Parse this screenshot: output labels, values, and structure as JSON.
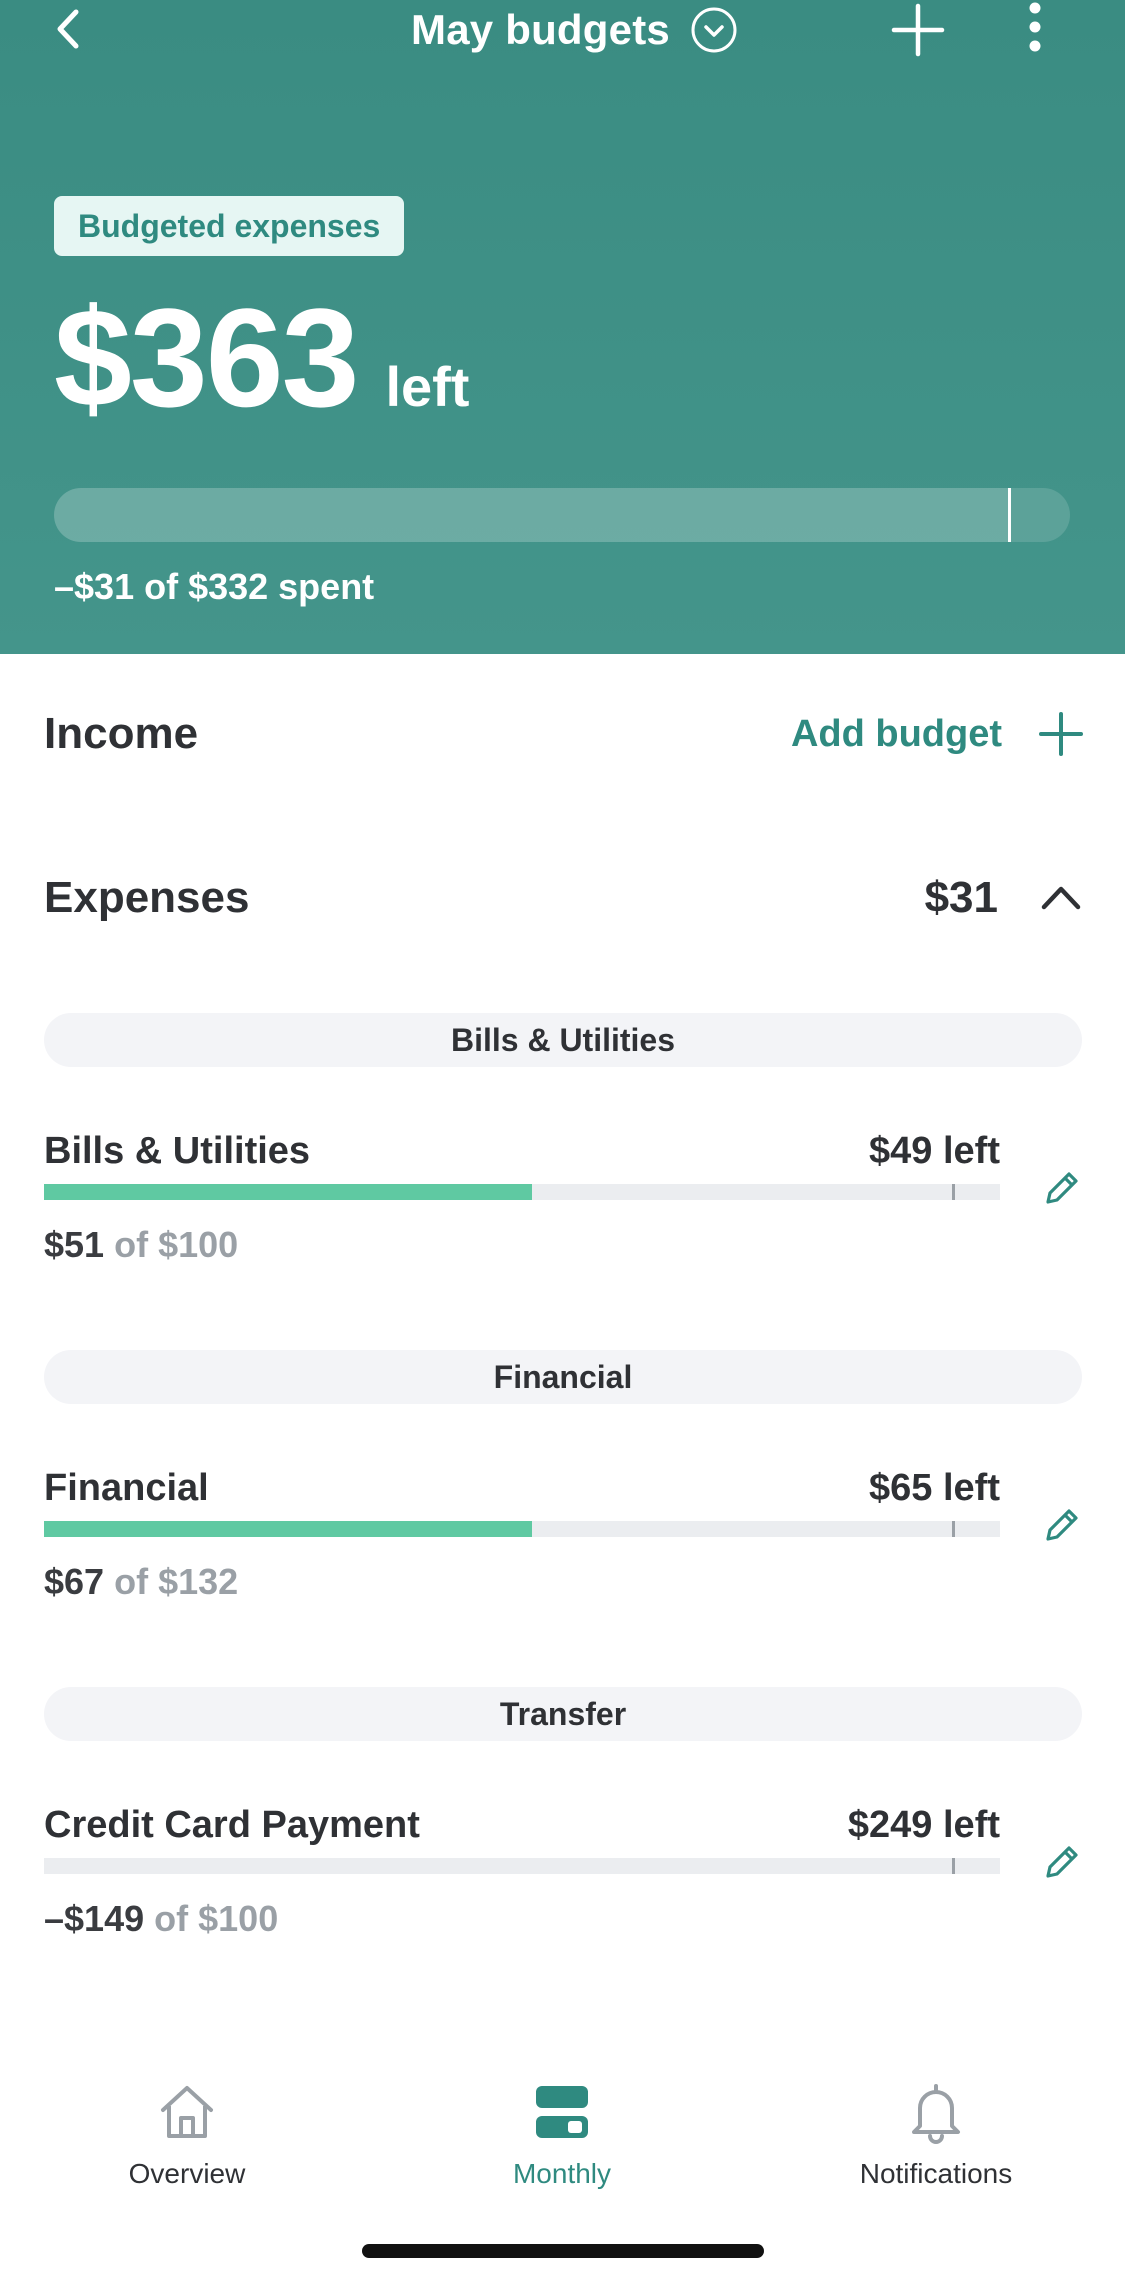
{
  "header": {
    "title": "May budgets",
    "badge": "Budgeted expenses",
    "amount": "$363",
    "amount_suffix": "left",
    "progress_fraction": 0.94,
    "caption": "–$31 of $332 spent"
  },
  "income": {
    "title": "Income",
    "add_label": "Add budget"
  },
  "expenses": {
    "title": "Expenses",
    "total": "$31",
    "groups": [
      {
        "group_label": "Bills & Utilities",
        "item": {
          "name": "Bills & Utilities",
          "left": "$49 left",
          "spent": "$51",
          "of": "of",
          "total": "$100",
          "progress": 0.51
        }
      },
      {
        "group_label": "Financial",
        "item": {
          "name": "Financial",
          "left": "$65 left",
          "spent": "$67",
          "of": "of",
          "total": "$132",
          "progress": 0.51
        }
      },
      {
        "group_label": "Transfer",
        "item": {
          "name": "Credit Card Payment",
          "left": "$249 left",
          "spent": "–$149",
          "of": "of",
          "total": "$100",
          "progress": 0
        }
      }
    ]
  },
  "nav": {
    "items": [
      {
        "label": "Overview",
        "icon": "home-icon"
      },
      {
        "label": "Monthly",
        "icon": "monthly-icon"
      },
      {
        "label": "Notifications",
        "icon": "bell-icon"
      }
    ],
    "active": "Monthly"
  },
  "colors": {
    "header_bg": "#3a8c82",
    "accent": "#2f8a80",
    "progress_green": "#5fc9a2",
    "pill_bg": "#f3f4f7"
  }
}
